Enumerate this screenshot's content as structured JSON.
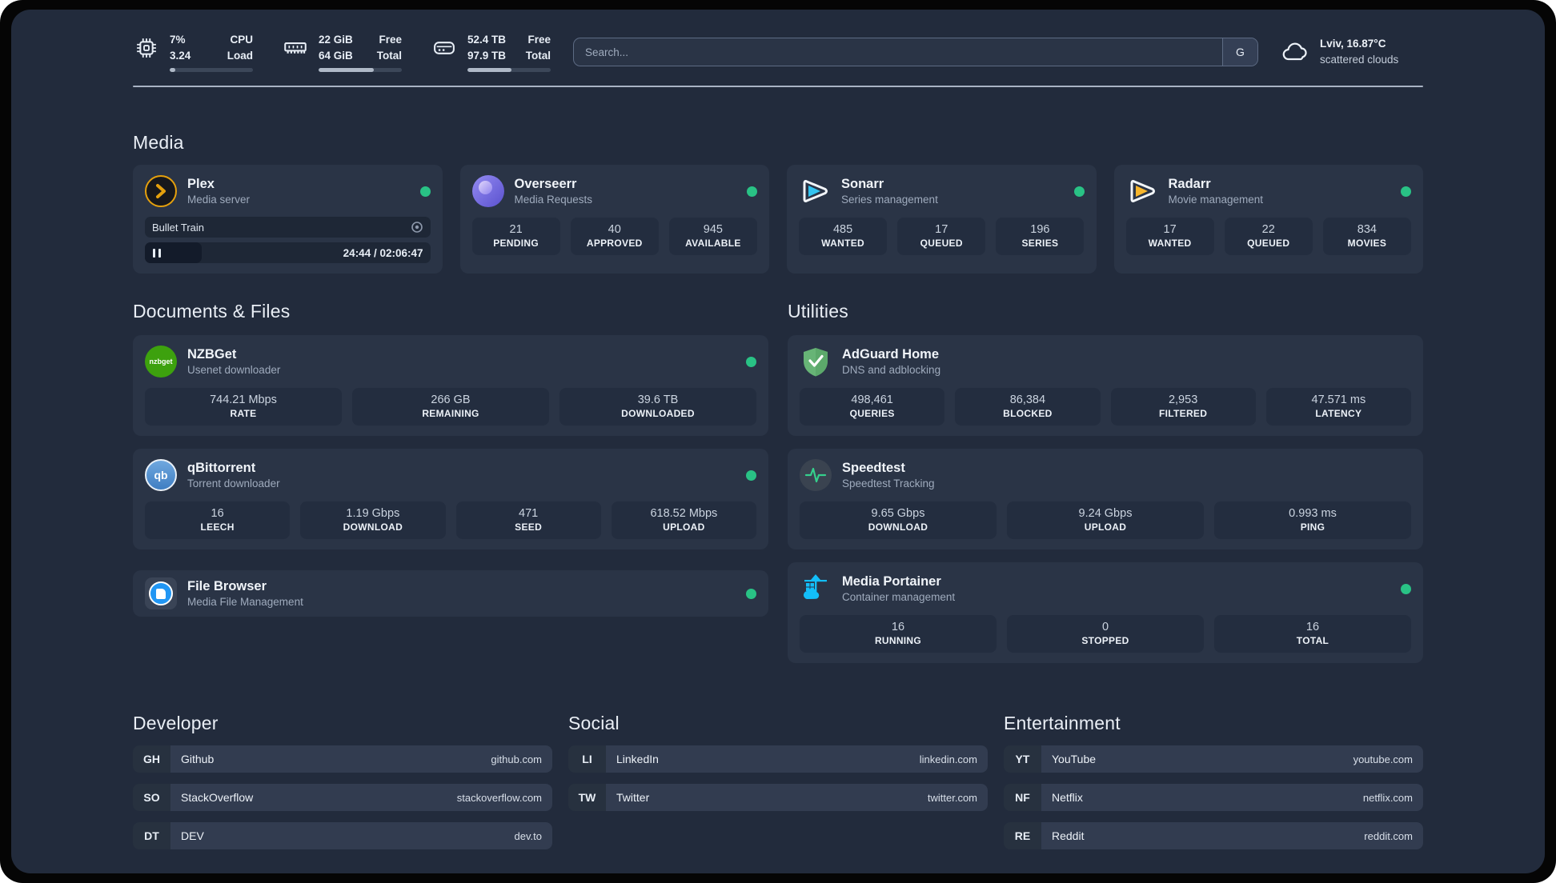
{
  "colors": {
    "background": "#222B3C",
    "card": "#2A3446",
    "tile": "#232D3F",
    "accent_green": "#29C285",
    "plex_orange": "#E5A00D",
    "sonarr_blue": "#33C4F0",
    "radarr_yellow": "#F8B62C",
    "adguard_green": "#67B476",
    "speedtest_green": "#35D08C",
    "portainer_blue": "#13BEF9"
  },
  "statusbar": {
    "cpu": {
      "value_line1": "7%",
      "value_line2": "3.24",
      "label_line1": "CPU",
      "label_line2": "Load",
      "progress_percent": 7
    },
    "memory": {
      "value_line1": "22 GiB",
      "value_line2": "64 GiB",
      "label_line1": "Free",
      "label_line2": "Total",
      "progress_percent": 66
    },
    "disk": {
      "value_line1": "52.4 TB",
      "value_line2": "97.9 TB",
      "label_line1": "Free",
      "label_line2": "Total",
      "progress_percent": 53
    }
  },
  "search": {
    "placeholder": "Search...",
    "engine_button": "G"
  },
  "weather": {
    "location": "Lviv, 16.87°C",
    "condition": "scattered clouds"
  },
  "sections": {
    "media": "Media",
    "documents": "Documents & Files",
    "utilities": "Utilities",
    "developer": "Developer",
    "social": "Social",
    "entertainment": "Entertainment"
  },
  "apps": {
    "plex": {
      "name": "Plex",
      "description": "Media server",
      "status": "online",
      "player": {
        "title": "Bullet Train",
        "time_display": "24:44 / 02:06:47",
        "state": "paused",
        "progress_percent": 20
      }
    },
    "overseerr": {
      "name": "Overseerr",
      "description": "Media Requests",
      "status": "online",
      "stats": [
        {
          "value": "21",
          "label": "PENDING"
        },
        {
          "value": "40",
          "label": "APPROVED"
        },
        {
          "value": "945",
          "label": "AVAILABLE"
        }
      ]
    },
    "sonarr": {
      "name": "Sonarr",
      "description": "Series management",
      "status": "online",
      "stats": [
        {
          "value": "485",
          "label": "WANTED"
        },
        {
          "value": "17",
          "label": "QUEUED"
        },
        {
          "value": "196",
          "label": "SERIES"
        }
      ]
    },
    "radarr": {
      "name": "Radarr",
      "description": "Movie management",
      "status": "online",
      "stats": [
        {
          "value": "17",
          "label": "WANTED"
        },
        {
          "value": "22",
          "label": "QUEUED"
        },
        {
          "value": "834",
          "label": "MOVIES"
        }
      ]
    },
    "nzbget": {
      "name": "NZBGet",
      "description": "Usenet downloader",
      "status": "online",
      "icon_text": "nzbget",
      "stats": [
        {
          "value": "744.21 Mbps",
          "label": "RATE"
        },
        {
          "value": "266 GB",
          "label": "REMAINING"
        },
        {
          "value": "39.6 TB",
          "label": "DOWNLOADED"
        }
      ]
    },
    "qbittorrent": {
      "name": "qBittorrent",
      "description": "Torrent downloader",
      "status": "online",
      "icon_text": "qb",
      "stats": [
        {
          "value": "16",
          "label": "LEECH"
        },
        {
          "value": "1.19 Gbps",
          "label": "DOWNLOAD"
        },
        {
          "value": "471",
          "label": "SEED"
        },
        {
          "value": "618.52 Mbps",
          "label": "UPLOAD"
        }
      ]
    },
    "filebrowser": {
      "name": "File Browser",
      "description": "Media File Management",
      "status": "online"
    },
    "adguard": {
      "name": "AdGuard Home",
      "description": "DNS and adblocking",
      "stats": [
        {
          "value": "498,461",
          "label": "QUERIES"
        },
        {
          "value": "86,384",
          "label": "BLOCKED"
        },
        {
          "value": "2,953",
          "label": "FILTERED"
        },
        {
          "value": "47.571 ms",
          "label": "LATENCY"
        }
      ]
    },
    "speedtest": {
      "name": "Speedtest",
      "description": "Speedtest Tracking",
      "stats": [
        {
          "value": "9.65 Gbps",
          "label": "DOWNLOAD"
        },
        {
          "value": "9.24 Gbps",
          "label": "UPLOAD"
        },
        {
          "value": "0.993 ms",
          "label": "PING"
        }
      ]
    },
    "portainer": {
      "name": "Media Portainer",
      "description": "Container management",
      "status": "online",
      "stats": [
        {
          "value": "16",
          "label": "RUNNING"
        },
        {
          "value": "0",
          "label": "STOPPED"
        },
        {
          "value": "16",
          "label": "TOTAL"
        }
      ]
    }
  },
  "links": {
    "developer": [
      {
        "abbr": "GH",
        "name": "Github",
        "url": "github.com"
      },
      {
        "abbr": "SO",
        "name": "StackOverflow",
        "url": "stackoverflow.com"
      },
      {
        "abbr": "DT",
        "name": "DEV",
        "url": "dev.to"
      }
    ],
    "social": [
      {
        "abbr": "LI",
        "name": "LinkedIn",
        "url": "linkedin.com"
      },
      {
        "abbr": "TW",
        "name": "Twitter",
        "url": "twitter.com"
      }
    ],
    "entertainment": [
      {
        "abbr": "YT",
        "name": "YouTube",
        "url": "youtube.com"
      },
      {
        "abbr": "NF",
        "name": "Netflix",
        "url": "netflix.com"
      },
      {
        "abbr": "RE",
        "name": "Reddit",
        "url": "reddit.com"
      }
    ]
  }
}
